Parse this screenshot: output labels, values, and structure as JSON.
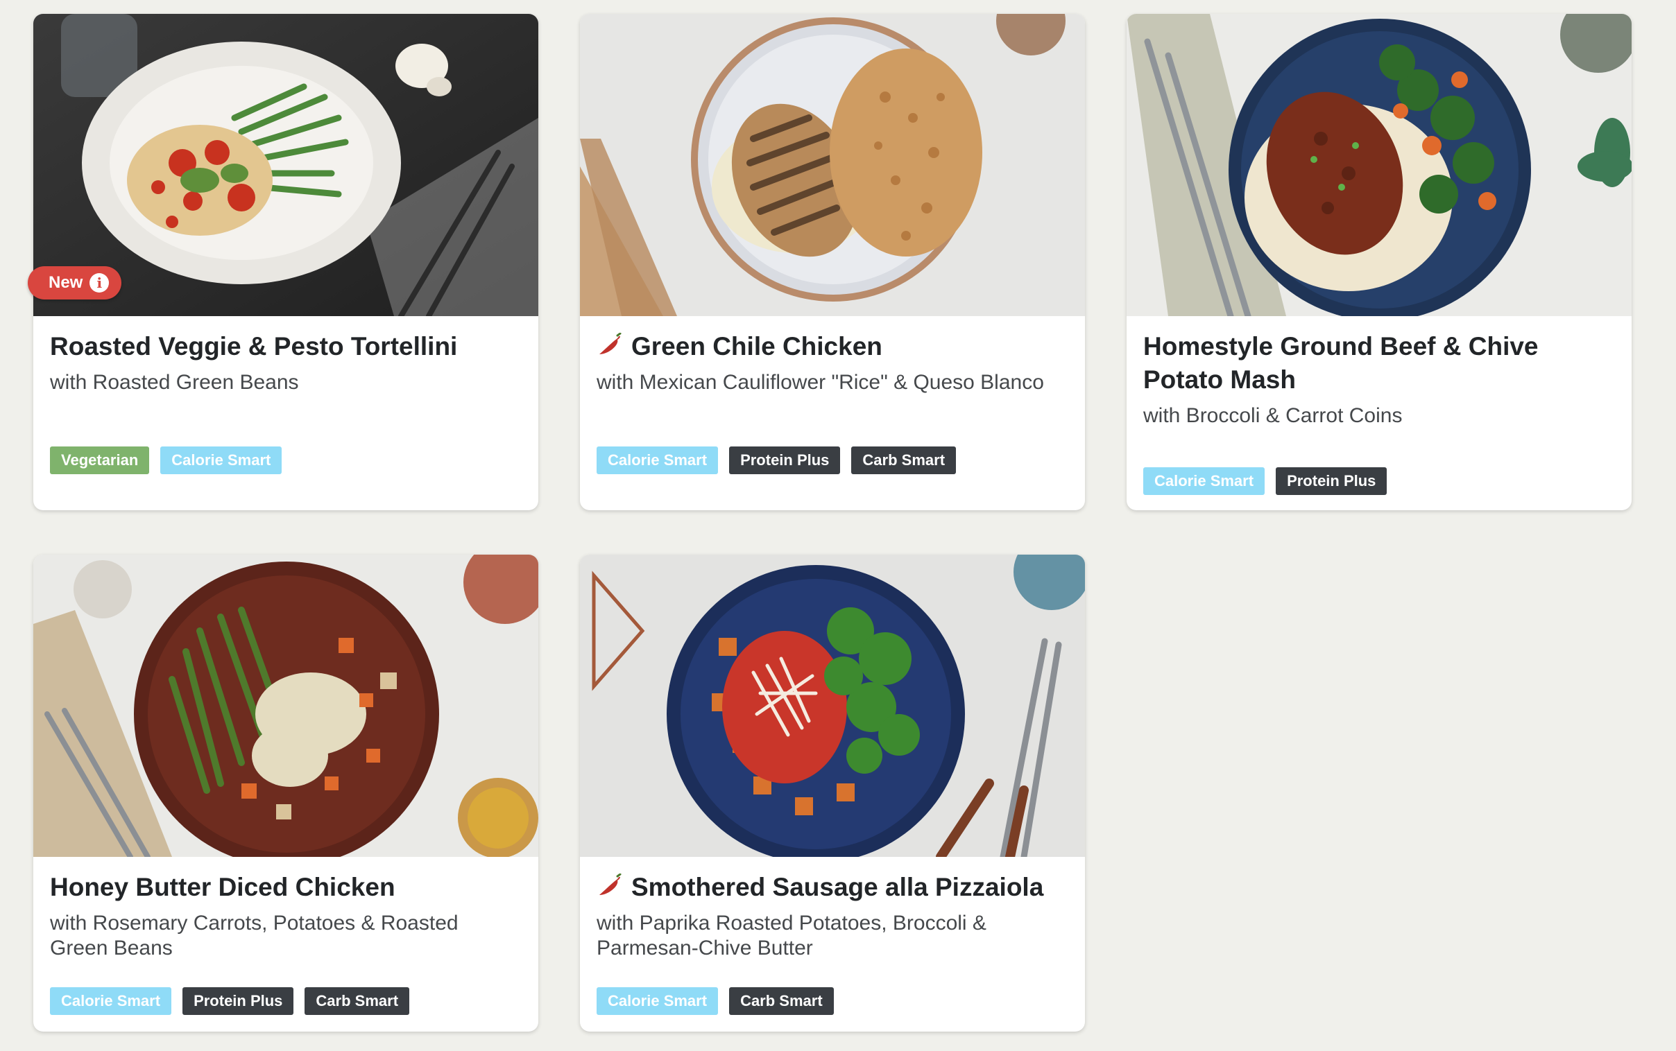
{
  "colors": {
    "background": "#f0f0eb",
    "new_badge": "#d9463f",
    "tag_vegetarian": "#7fb36c",
    "tag_calorie_smart": "#8fdbf7",
    "tag_dark": "#3a3e43",
    "spicy": "#c0322b"
  },
  "recipes": [
    {
      "title": "Roasted Veggie & Pesto Tortellini",
      "subtitle": "with Roasted Green Beans",
      "badge": "New",
      "badge_icon": "info-icon",
      "spicy": false,
      "tags": [
        "Vegetarian",
        "Calorie Smart"
      ]
    },
    {
      "title": "Green Chile Chicken",
      "subtitle": "with Mexican Cauliflower \"Rice\" & Queso Blanco",
      "spicy": true,
      "spicy_icon": "chili-pepper-icon",
      "tags": [
        "Calorie Smart",
        "Protein Plus",
        "Carb Smart"
      ]
    },
    {
      "title": "Homestyle Ground Beef & Chive Potato Mash",
      "subtitle": "with Broccoli & Carrot Coins",
      "spicy": false,
      "tags": [
        "Calorie Smart",
        "Protein Plus"
      ]
    },
    {
      "title": "Honey Butter Diced Chicken",
      "subtitle": "with Rosemary Carrots, Potatoes & Roasted Green Beans",
      "spicy": false,
      "tags": [
        "Calorie Smart",
        "Protein Plus",
        "Carb Smart"
      ]
    },
    {
      "title": "Smothered Sausage alla Pizzaiola",
      "subtitle": "with Paprika Roasted Potatoes, Broccoli & Parmesan-Chive Butter",
      "spicy": true,
      "spicy_icon": "chili-pepper-icon",
      "tags": [
        "Calorie Smart",
        "Carb Smart"
      ]
    }
  ]
}
